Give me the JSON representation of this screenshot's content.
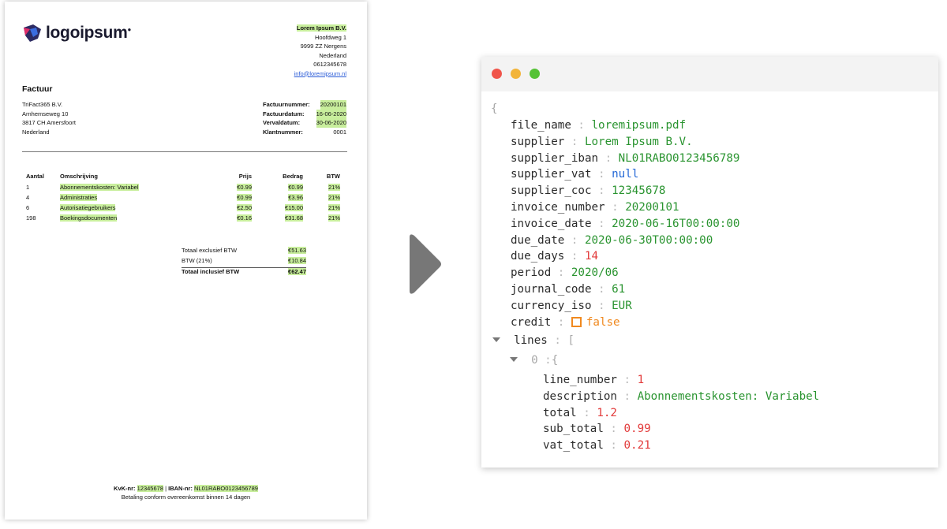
{
  "invoice": {
    "logo_text": "logoipsum",
    "supplier": {
      "name": "Lorem Ipsum B.V.",
      "address": "Hoofdweg 1",
      "postal_city": "9999 ZZ  Nergens",
      "country": "Nederland",
      "phone": "0612345678",
      "email": "info@loremipsum.nl"
    },
    "title": "Factuur",
    "customer": {
      "name": "TriFact365 B.V.",
      "address": "Arnhemseweg 10",
      "postal_city": "3817 CH  Amersfoort",
      "country": "Nederland"
    },
    "meta": [
      {
        "label": "Factuurnummer:",
        "value": "20200101"
      },
      {
        "label": "Factuurdatum:",
        "value": "16-06-2020"
      },
      {
        "label": "Vervaldatum:",
        "value": "30-06-2020"
      },
      {
        "label": "Klantnummer:",
        "value": "0001"
      }
    ],
    "lines_header": {
      "qty": "Aantal",
      "desc": "Omschrijving",
      "price": "Prijs",
      "amount": "Bedrag",
      "vat": "BTW"
    },
    "lines": [
      {
        "qty": "1",
        "desc": "Abonnementskosten: Variabel",
        "price": "€0.99",
        "amount": "€0.99",
        "vat": "21%"
      },
      {
        "qty": "4",
        "desc": "Administraties",
        "price": "€0.99",
        "amount": "€3.96",
        "vat": "21%"
      },
      {
        "qty": "6",
        "desc": "Autorisatiegebruikers",
        "price": "€2.50",
        "amount": "€15.00",
        "vat": "21%"
      },
      {
        "qty": "198",
        "desc": "Boekingsdocumenten",
        "price": "€0.16",
        "amount": "€31.68",
        "vat": "21%"
      }
    ],
    "totals": [
      {
        "label": "Totaal exclusief BTW",
        "value": "€51.63"
      },
      {
        "label": "BTW (21%)",
        "value": "€10.84"
      },
      {
        "label": "Totaal inclusief BTW",
        "value": "€62.47"
      }
    ],
    "footer": {
      "kvk_label": "KvK-nr:",
      "kvk": "12345678",
      "separator": " | ",
      "iban_label": "IBAN-nr:",
      "iban": "NL01RABO0123456789",
      "note": "Betaling conform overeenkomst binnen 14 dagen"
    }
  },
  "json_view": {
    "open_brace": "{",
    "colon": ":",
    "fields": [
      {
        "key": "file_name",
        "value": "loremipsum.pdf",
        "type": "string"
      },
      {
        "key": "supplier",
        "value": "Lorem Ipsum B.V.",
        "type": "string"
      },
      {
        "key": "supplier_iban",
        "value": "NL01RABO0123456789",
        "type": "string"
      },
      {
        "key": "supplier_vat",
        "value": "null",
        "type": "null"
      },
      {
        "key": "supplier_coc",
        "value": "12345678",
        "type": "string"
      },
      {
        "key": "invoice_number",
        "value": "20200101",
        "type": "string"
      },
      {
        "key": "invoice_date",
        "value": "2020-06-16T00:00:00",
        "type": "string"
      },
      {
        "key": "due_date",
        "value": "2020-06-30T00:00:00",
        "type": "string"
      },
      {
        "key": "due_days",
        "value": "14",
        "type": "number"
      },
      {
        "key": "period",
        "value": "2020/06",
        "type": "string"
      },
      {
        "key": "journal_code",
        "value": "61",
        "type": "string"
      },
      {
        "key": "currency_iso",
        "value": "EUR",
        "type": "string"
      },
      {
        "key": "credit",
        "value": "false",
        "type": "boolean"
      }
    ],
    "lines_key": "lines",
    "lines_open": "[",
    "item_index": "0",
    "item_open": "{",
    "item_fields": [
      {
        "key": "line_number",
        "value": "1",
        "type": "number"
      },
      {
        "key": "description",
        "value": "Abonnementskosten: Variabel",
        "type": "string"
      },
      {
        "key": "total",
        "value": "1.2",
        "type": "number"
      },
      {
        "key": "sub_total",
        "value": "0.99",
        "type": "number"
      },
      {
        "key": "vat_total",
        "value": "0.21",
        "type": "number"
      }
    ]
  }
}
